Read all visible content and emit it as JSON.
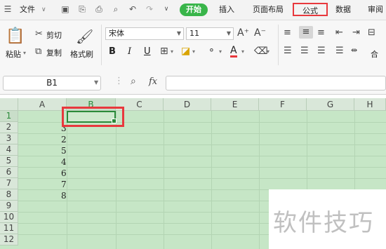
{
  "menubar": {
    "file": "文件",
    "tabs": [
      "开始",
      "插入",
      "页面布局",
      "公式",
      "数据",
      "审阅"
    ],
    "active_tab": "开始",
    "highlighted_tab": "公式"
  },
  "ribbon": {
    "paste": "粘贴",
    "cut": "剪切",
    "copy": "复制",
    "format_painter": "格式刷",
    "font_name": "宋体",
    "font_size": "11",
    "bold": "B",
    "italic": "I",
    "underline": "U",
    "font_color_letter": "A",
    "merge": "合"
  },
  "formula_bar": {
    "name_box": "B1",
    "fx_label": "fx",
    "formula": ""
  },
  "sheet": {
    "columns": [
      "A",
      "B",
      "C",
      "D",
      "E",
      "F",
      "G",
      "H"
    ],
    "rows": [
      "1",
      "2",
      "3",
      "4",
      "5",
      "6",
      "7",
      "8",
      "9",
      "10",
      "11",
      "12"
    ],
    "column_b_values": [
      "",
      "3",
      "2",
      "5",
      "4",
      "6",
      "7",
      "8"
    ],
    "selected_cell": "B1"
  },
  "watermark": "软件技巧",
  "colors": {
    "accent_green": "#39b54a",
    "highlight_red": "#e8383d",
    "sheet_background": "#c6e6c6"
  }
}
